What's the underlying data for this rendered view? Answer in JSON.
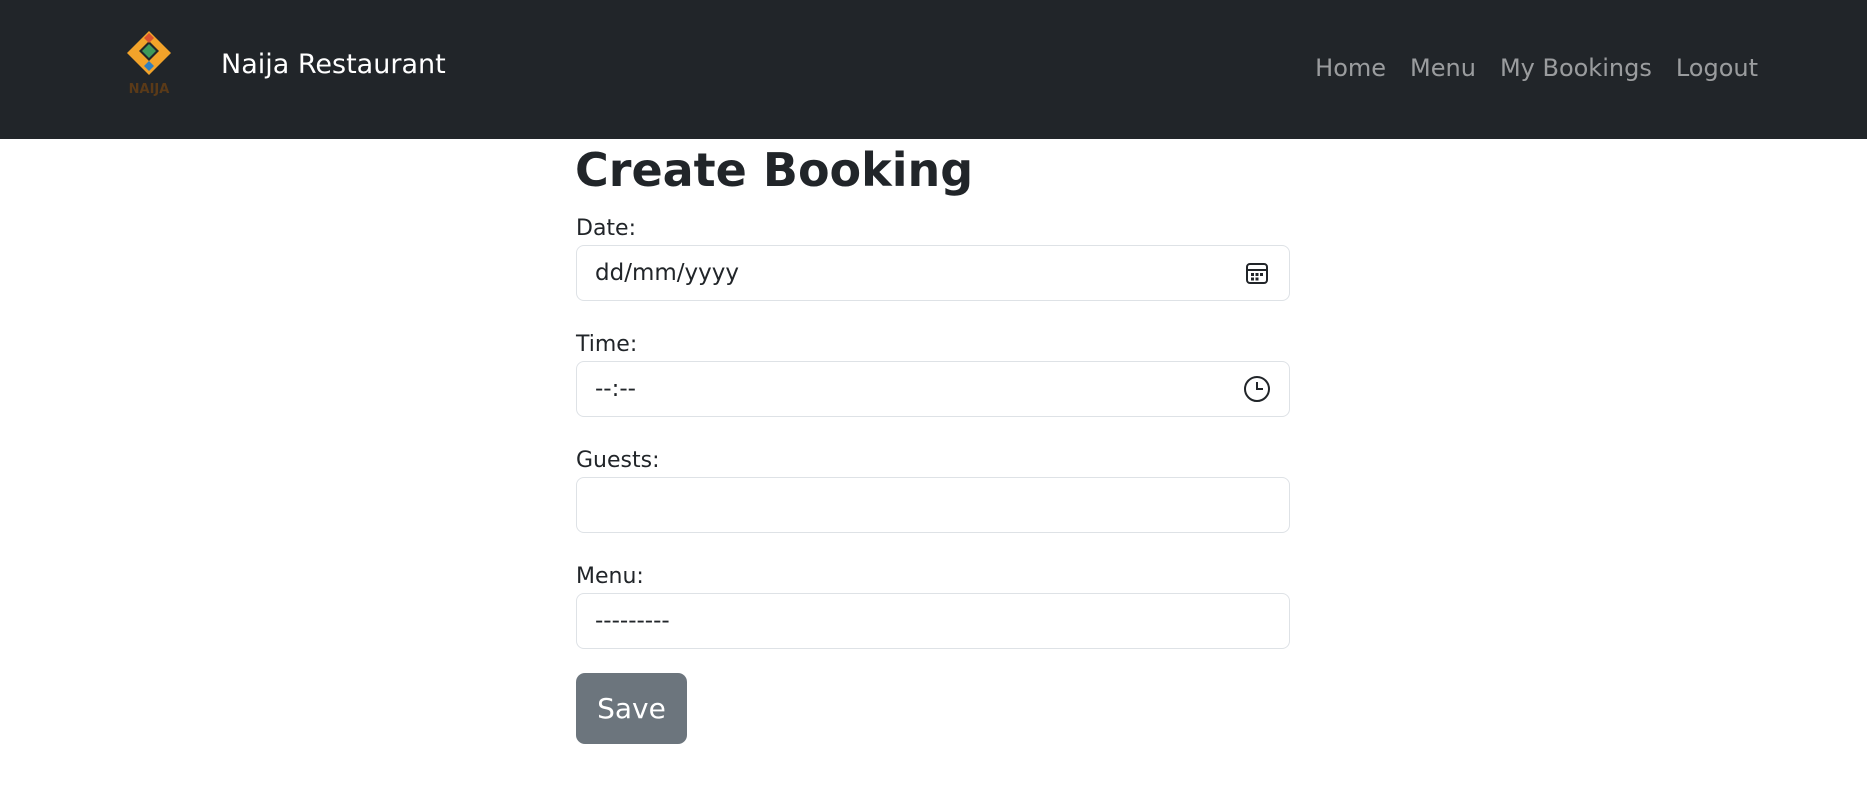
{
  "navbar": {
    "brand": "Naija Restaurant",
    "logo_text": "NAIJA",
    "links": [
      "Home",
      "Menu",
      "My Bookings",
      "Logout"
    ]
  },
  "form": {
    "title": "Create Booking",
    "date_label": "Date:",
    "date_value": "dd/mm/yyyy",
    "time_label": "Time:",
    "time_value": "--:--",
    "guests_label": "Guests:",
    "guests_value": "",
    "menu_label": "Menu:",
    "menu_value": "---------",
    "save_label": "Save"
  },
  "icons": {
    "date": "calendar-icon",
    "time": "clock-icon"
  },
  "colors": {
    "navbar_bg": "#212529",
    "brand_text": "#ffffff",
    "nav_link": "#9a9da0",
    "save_bg": "#6c757d",
    "logo_orange": "#f2a32a",
    "logo_red": "#d9532f",
    "logo_blue": "#2f7fbf",
    "logo_green": "#3f9a5a"
  }
}
